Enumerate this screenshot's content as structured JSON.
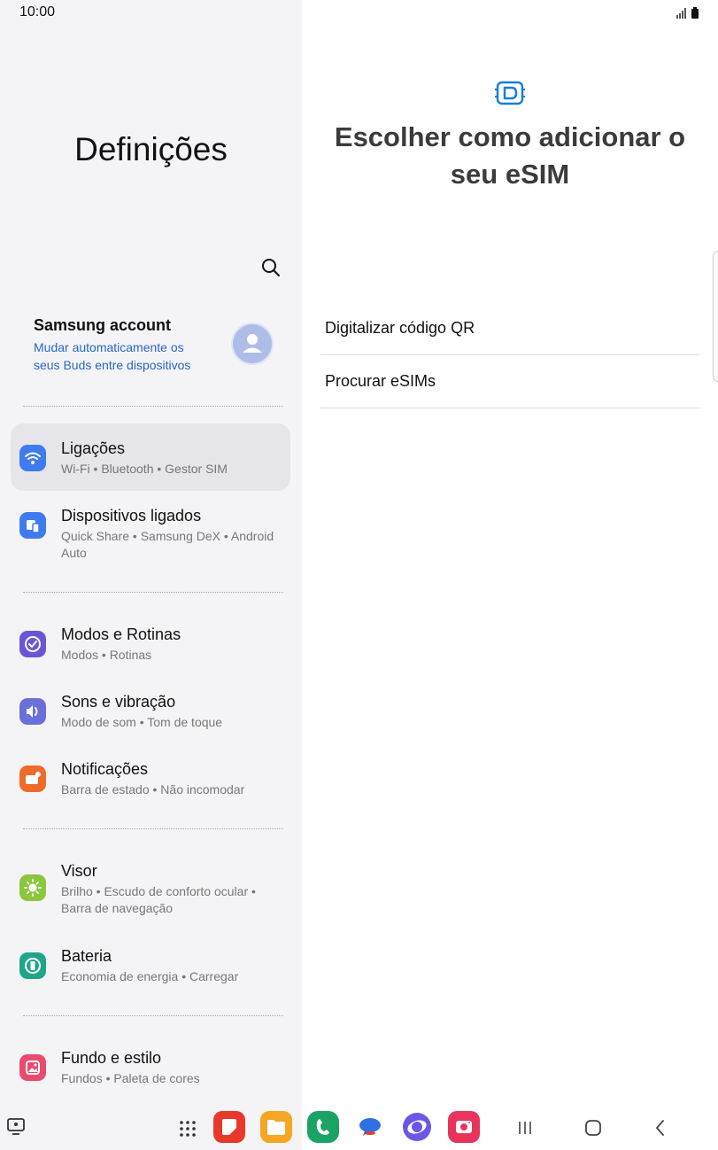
{
  "status": {
    "time": "10:00"
  },
  "settings": {
    "title": "Definições",
    "account": {
      "title": "Samsung account",
      "subtitle": "Mudar automaticamente os seus Buds entre dispositivos"
    },
    "items": [
      {
        "label": "Ligações",
        "sub": "Wi-Fi  •  Bluetooth  •  Gestor SIM",
        "icon": "wifi-icon",
        "color": "#3d7bef",
        "selected": true
      },
      {
        "label": "Dispositivos ligados",
        "sub": "Quick Share  •  Samsung DeX  •  Android Auto",
        "icon": "connected-devices-icon",
        "color": "#3d7bef"
      },
      {
        "label": "Modos e Rotinas",
        "sub": "Modos  •  Rotinas",
        "icon": "modes-icon",
        "color": "#6b55d6"
      },
      {
        "label": "Sons e vibração",
        "sub": "Modo de som  •  Tom de toque",
        "icon": "sound-icon",
        "color": "#6b6fd9"
      },
      {
        "label": "Notificações",
        "sub": "Barra de estado  •  Não incomodar",
        "icon": "notifications-icon",
        "color": "#ee6b2a"
      },
      {
        "label": "Visor",
        "sub": "Brilho  •  Escudo de conforto ocular  •  Barra de navegação",
        "icon": "display-icon",
        "color": "#8cc63e"
      },
      {
        "label": "Bateria",
        "sub": "Economia de energia  •  Carregar",
        "icon": "battery-icon",
        "color": "#1fa58a"
      },
      {
        "label": "Fundo e estilo",
        "sub": "Fundos  •  Paleta de cores",
        "icon": "wallpaper-icon",
        "color": "#ea4a6e"
      }
    ]
  },
  "esim": {
    "title": "Escolher como adicionar o seu eSIM",
    "options": [
      "Digitalizar código QR",
      "Procurar eSIMs"
    ]
  },
  "taskbar": {
    "apps": [
      {
        "name": "all-apps-icon"
      },
      {
        "name": "samsung-notes-icon",
        "color": "#e8382c"
      },
      {
        "name": "my-files-icon",
        "color": "#f5a623"
      },
      {
        "name": "phone-icon",
        "color": "#1aa365"
      },
      {
        "name": "messages-icon",
        "color": "#2f6fe4"
      },
      {
        "name": "internet-icon",
        "color": "#6a57e6"
      },
      {
        "name": "camera-icon",
        "color": "#e8345c"
      }
    ],
    "nav": [
      "recents-button",
      "home-button",
      "back-button"
    ]
  }
}
